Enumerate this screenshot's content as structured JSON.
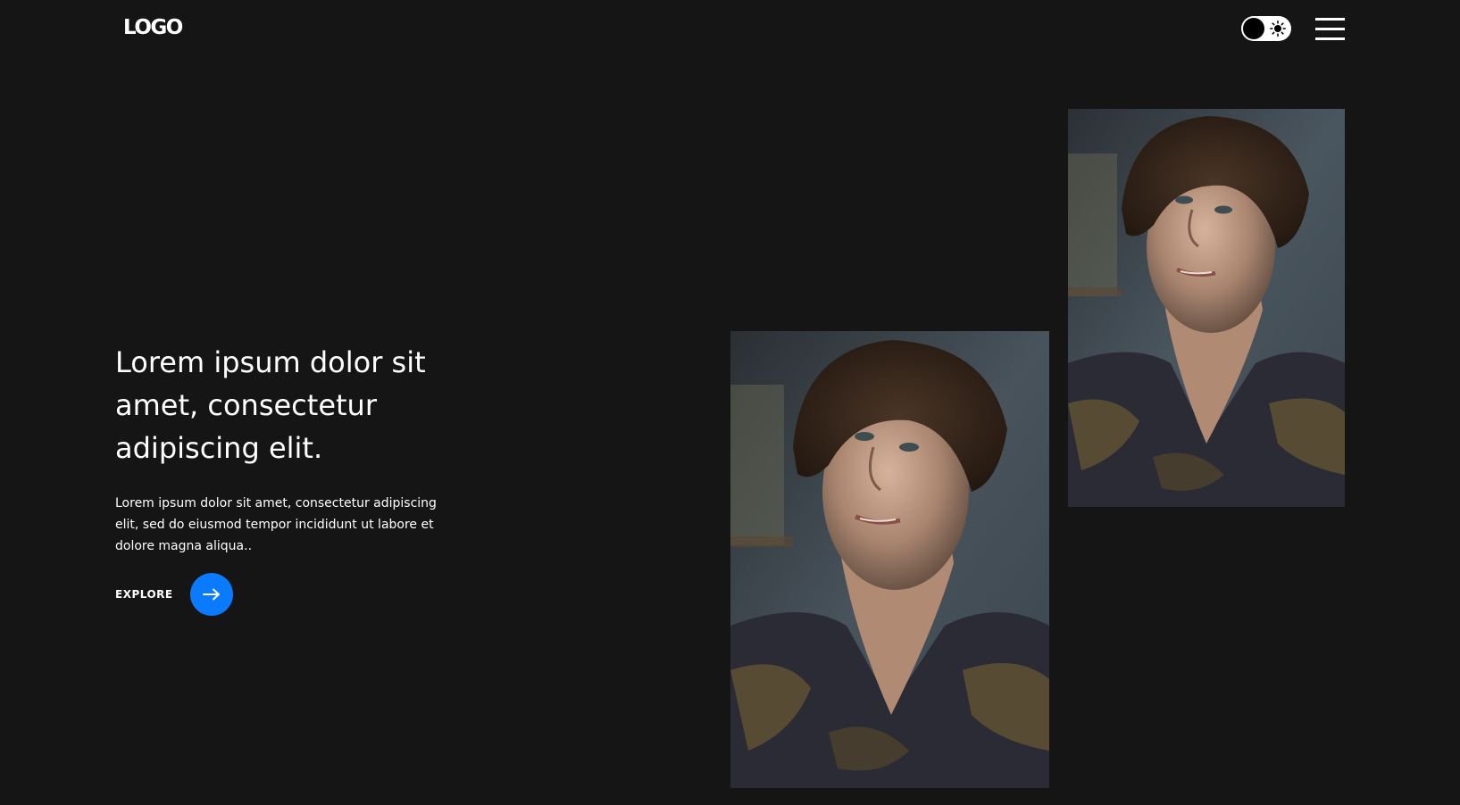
{
  "header": {
    "logo_text": "LOGO",
    "theme_toggle_icon": "sun-icon",
    "menu_icon": "hamburger-menu-icon"
  },
  "hero": {
    "title": "Lorem ipsum dolor sit amet, consectetur adipiscing elit.",
    "description": "Lorem ipsum dolor sit amet, consectetur adipiscing elit, sed do eiusmod tempor incididunt ut labore et dolore magna aliqua..",
    "explore_label": "EXPLORE",
    "explore_icon": "arrow-right-icon"
  },
  "colors": {
    "background": "#151515",
    "accent": "#0a7aff",
    "text": "#ffffff"
  },
  "images": [
    {
      "name": "portrait-photo-large",
      "description": ""
    },
    {
      "name": "portrait-photo-small",
      "description": ""
    }
  ]
}
